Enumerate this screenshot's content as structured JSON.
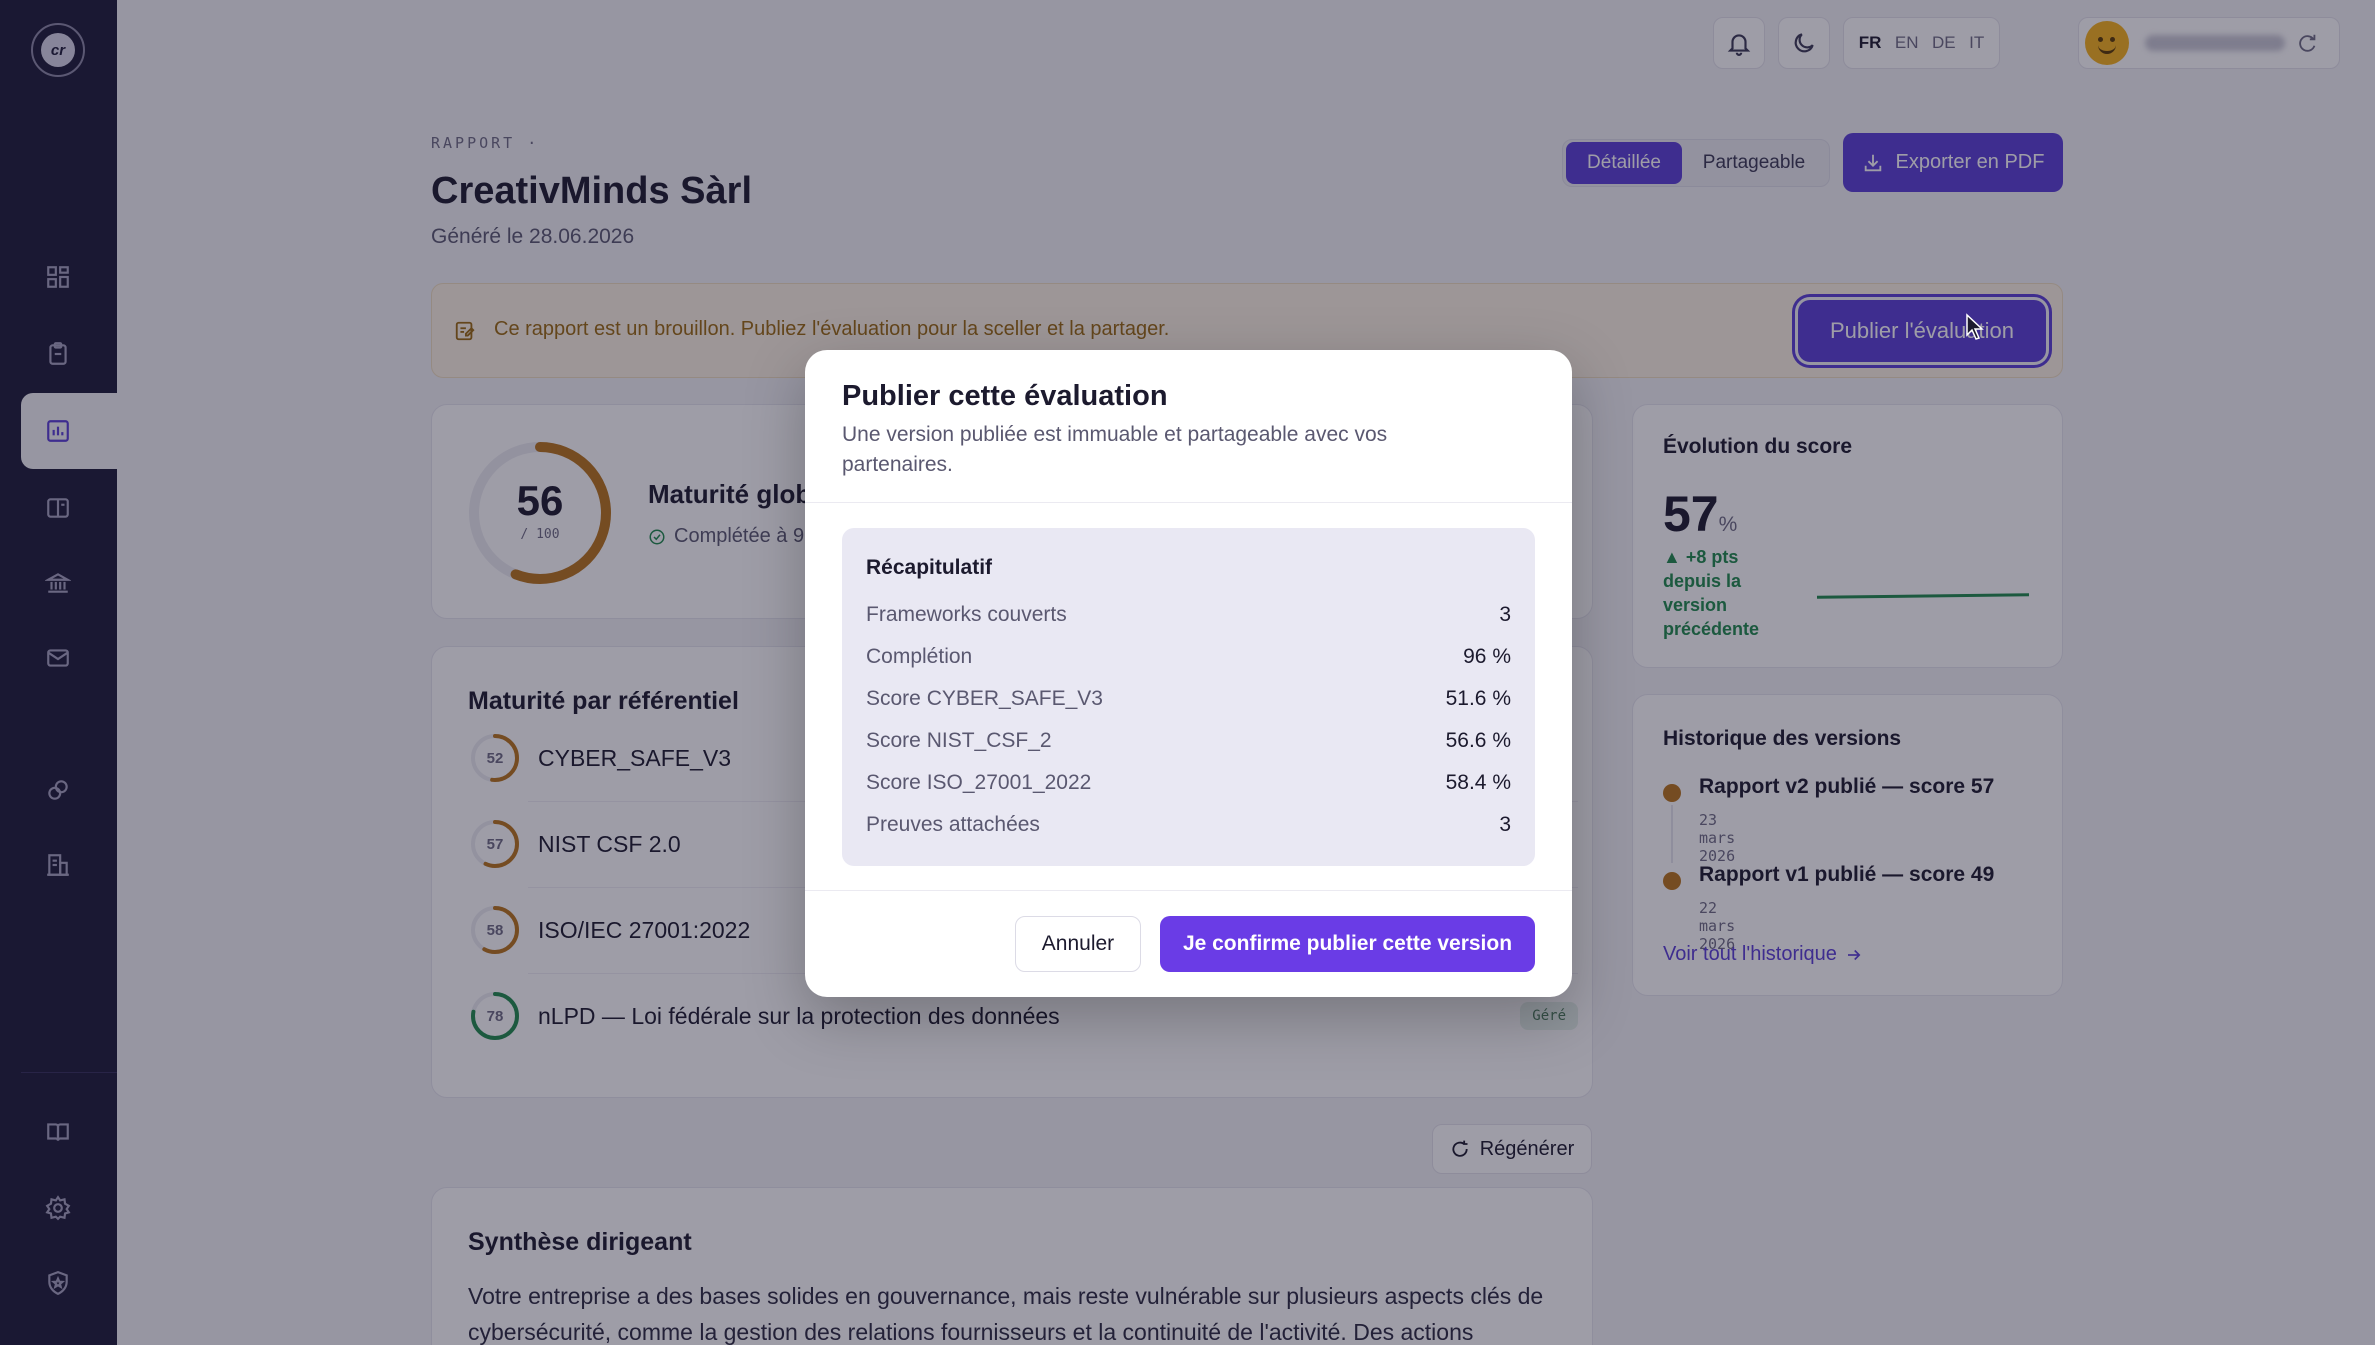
{
  "app": {
    "logo_text": "cr"
  },
  "sidebar": {
    "items": [
      {
        "name": "dashboard",
        "icon": "grid-icon"
      },
      {
        "name": "assessments",
        "icon": "clipboard-icon"
      },
      {
        "name": "reports",
        "icon": "bar-chart-icon",
        "active": true
      },
      {
        "name": "frameworks",
        "icon": "book-open-icon"
      },
      {
        "name": "organizations",
        "icon": "building-columns-icon"
      },
      {
        "name": "messages",
        "icon": "mail-icon"
      },
      {
        "name": "integrations",
        "icon": "link-icon"
      },
      {
        "name": "companies",
        "icon": "office-icon"
      }
    ],
    "bottom": [
      {
        "name": "docs",
        "icon": "book-icon"
      },
      {
        "name": "settings",
        "icon": "gear-icon"
      },
      {
        "name": "admin",
        "icon": "shield-icon"
      }
    ]
  },
  "topbar": {
    "languages": [
      "FR",
      "EN",
      "DE",
      "IT"
    ],
    "active_language": "FR"
  },
  "header": {
    "eyebrow": "RAPPORT  ·",
    "title": "CreativMinds Sàrl",
    "generated": "Généré le 28.06.2026",
    "view_detailed": "Détaillée",
    "view_shareable": "Partageable",
    "export_label": "Exporter en PDF"
  },
  "banner": {
    "text": "Ce rapport est un brouillon. Publiez l'évaluation pour la sceller et la partager.",
    "publish_label": "Publier l'évaluation"
  },
  "maturity": {
    "score": 56,
    "score_fraction": 0.56,
    "denominator": "/ 100",
    "title": "Maturité glob",
    "subtitle": "Complétée à 9"
  },
  "frameworks_card": {
    "title": "Maturité par référentiel",
    "items": [
      {
        "score": "52",
        "fraction": 0.52,
        "name": "CYBER_SAFE_V3",
        "color": "#b8741a"
      },
      {
        "score": "57",
        "fraction": 0.57,
        "name": "NIST CSF 2.0",
        "color": "#b8741a"
      },
      {
        "score": "58",
        "fraction": 0.58,
        "name": "ISO/IEC 27001:2022",
        "color": "#b8741a"
      },
      {
        "score": "78",
        "fraction": 0.78,
        "name": "nLPD — Loi fédérale sur la protection des données",
        "color": "#1f8a4c",
        "badge": "Géré"
      }
    ]
  },
  "regen_label": "Régénérer",
  "summary": {
    "title": "Synthèse dirigeant",
    "text": "Votre entreprise a des bases solides en gouvernance, mais reste vulnérable sur plusieurs aspects clés de cybersécurité, comme la gestion des relations fournisseurs et la continuité de l'activité. Des actions"
  },
  "evolution": {
    "title": "Évolution du score",
    "score": "57",
    "unit": "%",
    "delta": "▲ +8 pts depuis la version précédente",
    "spark": [
      49,
      57
    ]
  },
  "history": {
    "title": "Historique des versions",
    "items": [
      {
        "label": "Rapport v2 publié — score 57",
        "date": "23 mars 2026"
      },
      {
        "label": "Rapport v1 publié — score 49",
        "date": "22 mars 2026"
      }
    ],
    "link": "Voir tout l'historique"
  },
  "modal": {
    "title": "Publier cette évaluation",
    "description": "Une version publiée est immuable et partageable avec vos partenaires.",
    "recap_title": "Récapitulatif",
    "rows": [
      {
        "label": "Frameworks couverts",
        "value": "3"
      },
      {
        "label": "Complétion",
        "value": "96 %"
      },
      {
        "label": "Score CYBER_SAFE_V3",
        "value": "51.6 %"
      },
      {
        "label": "Score NIST_CSF_2",
        "value": "56.6 %"
      },
      {
        "label": "Score ISO_27001_2022",
        "value": "58.4 %"
      },
      {
        "label": "Preuves attachées",
        "value": "3"
      }
    ],
    "cancel_label": "Annuler",
    "confirm_label": "Je confirme publier cette version"
  },
  "colors": {
    "accent": "#5b3fd6",
    "sidebar": "#1d1a37",
    "warning": "#b8741a",
    "success": "#1f8a4c"
  }
}
